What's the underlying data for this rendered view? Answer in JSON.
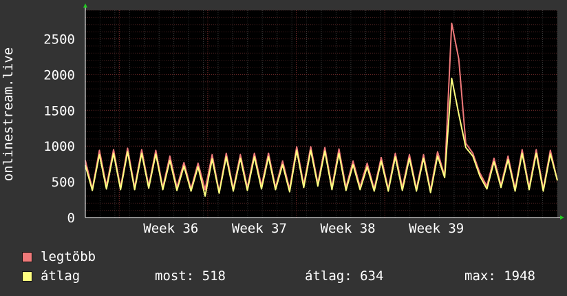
{
  "chart_data": {
    "type": "line",
    "title": "",
    "ylabel": "onlinestream.live",
    "xlabel": "",
    "ylim": [
      0,
      2900
    ],
    "yticks": [
      0,
      500,
      1000,
      1500,
      2000,
      2500
    ],
    "xticks": [
      "Week 36",
      "Week 37",
      "Week 38",
      "Week 39"
    ],
    "x_range_days": [
      0,
      32
    ],
    "week_starts": [
      2.3,
      8.3,
      14.3,
      20.3
    ],
    "grid": true,
    "legend_placement": "bottom-left",
    "series": [
      {
        "name": "legtöbb",
        "color": "#f07a7a",
        "values": [
          800,
          400,
          940,
          440,
          950,
          420,
          970,
          420,
          950,
          440,
          940,
          420,
          860,
          420,
          770,
          400,
          760,
          390,
          880,
          360,
          900,
          400,
          880,
          420,
          900,
          440,
          900,
          420,
          790,
          400,
          990,
          460,
          990,
          480,
          980,
          420,
          960,
          420,
          790,
          430,
          760,
          400,
          840,
          400,
          900,
          420,
          880,
          400,
          880,
          380,
          920,
          580,
          2720,
          2220,
          1040,
          900,
          620,
          440,
          830,
          450,
          860,
          400,
          950,
          420,
          950,
          400,
          940,
          520
        ]
      },
      {
        "name": "átlag",
        "color": "#ffff80",
        "values": [
          730,
          380,
          880,
          400,
          900,
          390,
          920,
          390,
          900,
          410,
          890,
          390,
          800,
          380,
          720,
          370,
          710,
          300,
          820,
          340,
          850,
          370,
          830,
          380,
          850,
          400,
          850,
          390,
          740,
          360,
          940,
          420,
          940,
          440,
          930,
          390,
          900,
          380,
          740,
          390,
          710,
          370,
          790,
          370,
          850,
          380,
          830,
          370,
          830,
          350,
          860,
          560,
          1948,
          1450,
          980,
          860,
          580,
          400,
          780,
          420,
          810,
          370,
          900,
          390,
          900,
          370,
          890,
          518
        ]
      }
    ]
  },
  "legend": {
    "items": [
      {
        "label": "legtöbb",
        "color": "#f07a7a"
      },
      {
        "label": "átlag",
        "color": "#ffff80"
      }
    ],
    "stats": {
      "most": "most: 518",
      "atlag": "átlag: 634",
      "max": "max: 1948"
    }
  }
}
